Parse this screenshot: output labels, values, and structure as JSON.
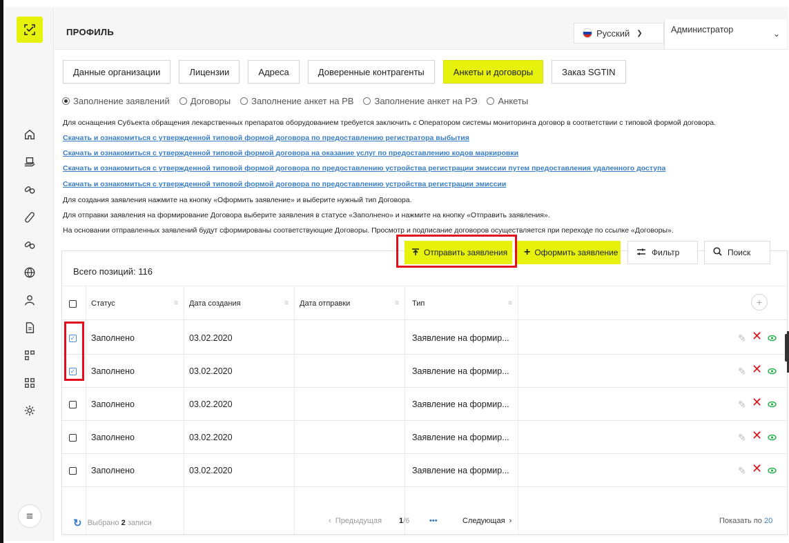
{
  "header": {
    "title": "ПРОФИЛЬ",
    "language": "Русский",
    "user": "Администратор"
  },
  "tabs": [
    {
      "label": "Данные организации",
      "active": false
    },
    {
      "label": "Лицензии",
      "active": false
    },
    {
      "label": "Адреса",
      "active": false
    },
    {
      "label": "Доверенные контрагенты",
      "active": false
    },
    {
      "label": "Анкеты и договоры",
      "active": true
    },
    {
      "label": "Заказ SGTIN",
      "active": false
    }
  ],
  "radios": [
    {
      "label": "Заполнение заявлений",
      "selected": true
    },
    {
      "label": "Договоры",
      "selected": false
    },
    {
      "label": "Заполнение анкет на РВ",
      "selected": false
    },
    {
      "label": "Заполнение анкет на РЭ",
      "selected": false
    },
    {
      "label": "Анкеты",
      "selected": false
    }
  ],
  "info": {
    "intro": "Для оснащения Субъекта обращения лекарственных препаратов оборудованием требуется заключить с Оператором системы мониторинга договор в соответствии с типовой формой договора.",
    "links": [
      "Скачать и ознакомиться с утвержденной типовой формой договора по предоставлению регистратора выбытия",
      "Скачать и ознакомиться с утвержденной типовой формой договора на оказание услуг по предоставлению кодов маркировки",
      "Скачать и ознакомиться с утвержденной типовой формой договора по предоставлению устройства регистрации эмиссии путем предоставления удаленного доступа",
      "Скачать и ознакомиться с утвержденной типовой формой договора по предоставлению устройства регистрации эмиссии"
    ],
    "notes": [
      "Для создания заявления нажмите на кнопку «Оформить заявление» и выберите нужный тип Договора.",
      "Для отправки заявления на формирование Договора выберите заявления в статусе «Заполнено» и нажмите на кнопку «Отправить заявления».",
      "На основании отправленных заявлений будут сформированы соответствующие Договоры. Просмотр и подписание договоров осуществляется при переходе по ссылке «Договоры»."
    ]
  },
  "toolbar": {
    "send": "Отправить заявления",
    "create": "Оформить заявление",
    "filter": "Фильтр",
    "search": "Поиск"
  },
  "table": {
    "total_label": "Всего позиций: 116",
    "columns": [
      "Статус",
      "Дата создания",
      "Дата отправки",
      "Тип"
    ],
    "rows": [
      {
        "checked": true,
        "status": "Заполнено",
        "created": "03.02.2020",
        "sent": "",
        "type": "Заявление на формир..."
      },
      {
        "checked": true,
        "status": "Заполнено",
        "created": "03.02.2020",
        "sent": "",
        "type": "Заявление на формир..."
      },
      {
        "checked": false,
        "status": "Заполнено",
        "created": "03.02.2020",
        "sent": "",
        "type": "Заявление на формир..."
      },
      {
        "checked": false,
        "status": "Заполнено",
        "created": "03.02.2020",
        "sent": "",
        "type": "Заявление на формир..."
      },
      {
        "checked": false,
        "status": "Заполнено",
        "created": "03.02.2020",
        "sent": "",
        "type": "Заявление на формир..."
      }
    ]
  },
  "footer": {
    "selected_prefix": "Выбрано",
    "selected_count": "2",
    "selected_suffix": "записи",
    "prev": "Предыдущая",
    "page_current": "1",
    "page_total": "/6",
    "ellipsis": "•••",
    "next": "Следующая",
    "show_label": "Показать по",
    "show_value": "20"
  },
  "colors": {
    "accent": "#e6f20c",
    "highlight": "#e30e1b",
    "link": "#3a7fc6",
    "delete": "#e30e1b",
    "view": "#2bb24c"
  }
}
